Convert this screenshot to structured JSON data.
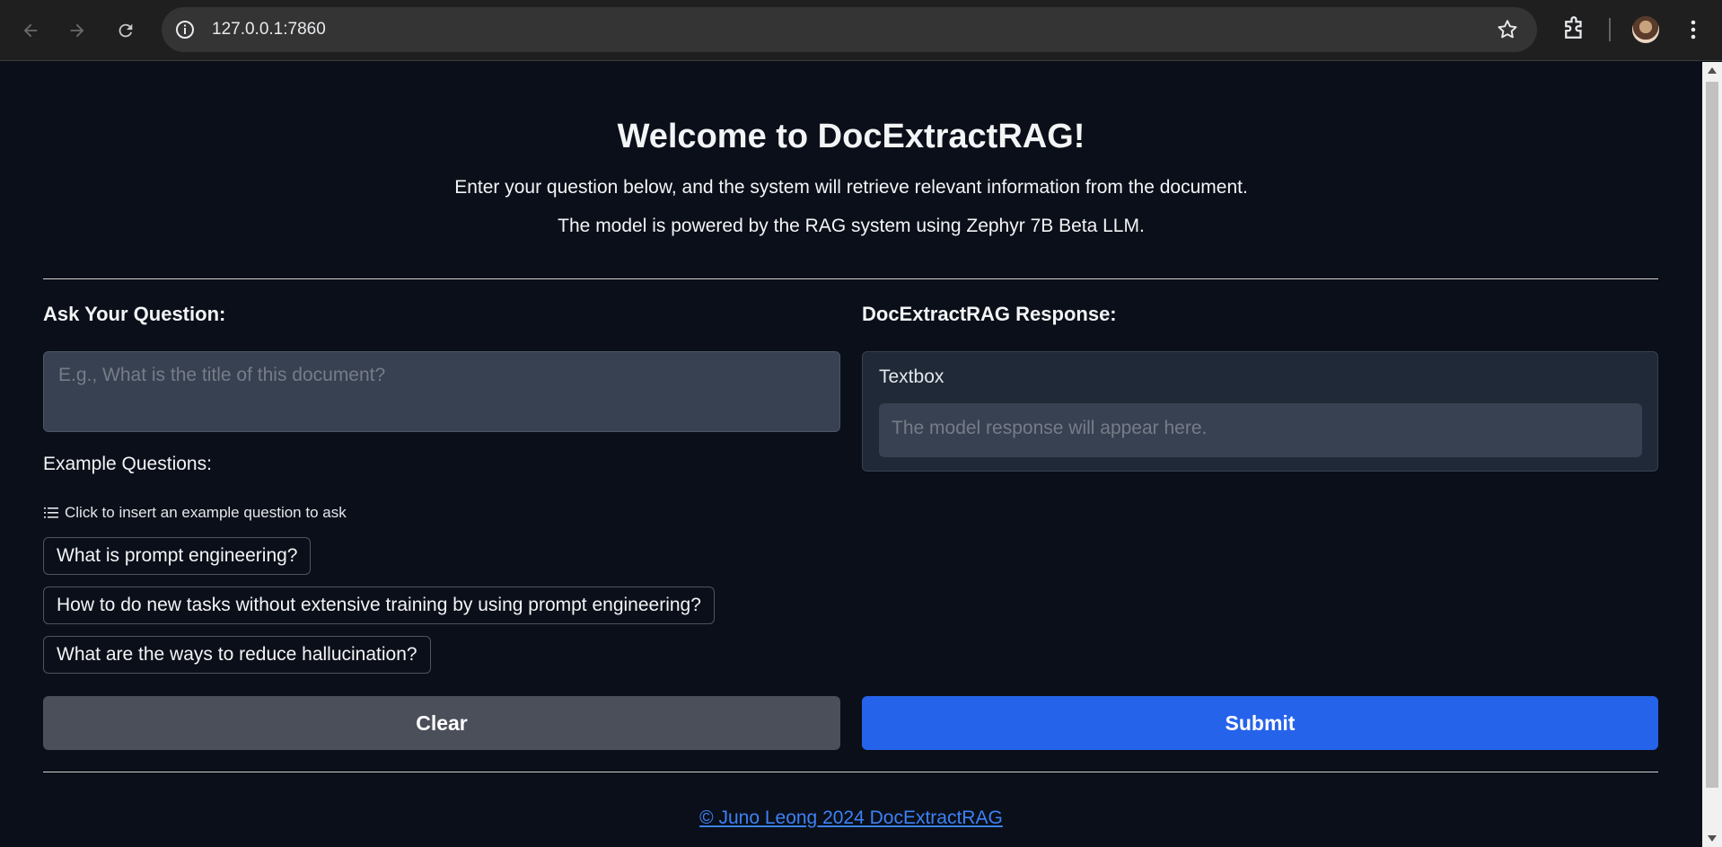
{
  "browser": {
    "url": "127.0.0.1:7860"
  },
  "header": {
    "title": "Welcome to DocExtractRAG!",
    "subtitle_1": "Enter your question below, and the system will retrieve relevant information from the document.",
    "subtitle_2": "The model is powered by the RAG system using Zephyr 7B Beta LLM."
  },
  "left": {
    "label": "Ask Your Question:",
    "question_placeholder": "E.g., What is the title of this document?",
    "question_value": "",
    "examples_title": "Example Questions:",
    "examples_hint": "Click to insert an example question to ask",
    "examples": [
      "What is prompt engineering?",
      "How to do new tasks without extensive training by using prompt engineering?",
      "What are the ways to reduce hallucination?"
    ],
    "clear_label": "Clear"
  },
  "right": {
    "label": "DocExtractRAG Response:",
    "textbox_label": "Textbox",
    "response_placeholder": "The model response will appear here.",
    "submit_label": "Submit"
  },
  "footer": {
    "link_text": "© Juno Leong 2024 DocExtractRAG"
  },
  "colors": {
    "background": "#0b0f19",
    "accent": "#2563eb",
    "link": "#3b82f6",
    "clear_button": "#4b4f5a"
  },
  "icons": [
    "back-arrow-icon",
    "forward-arrow-icon",
    "reload-icon",
    "site-info-icon",
    "bookmark-star-icon",
    "extensions-icon",
    "profile-avatar",
    "kebab-menu-icon",
    "list-icon"
  ]
}
